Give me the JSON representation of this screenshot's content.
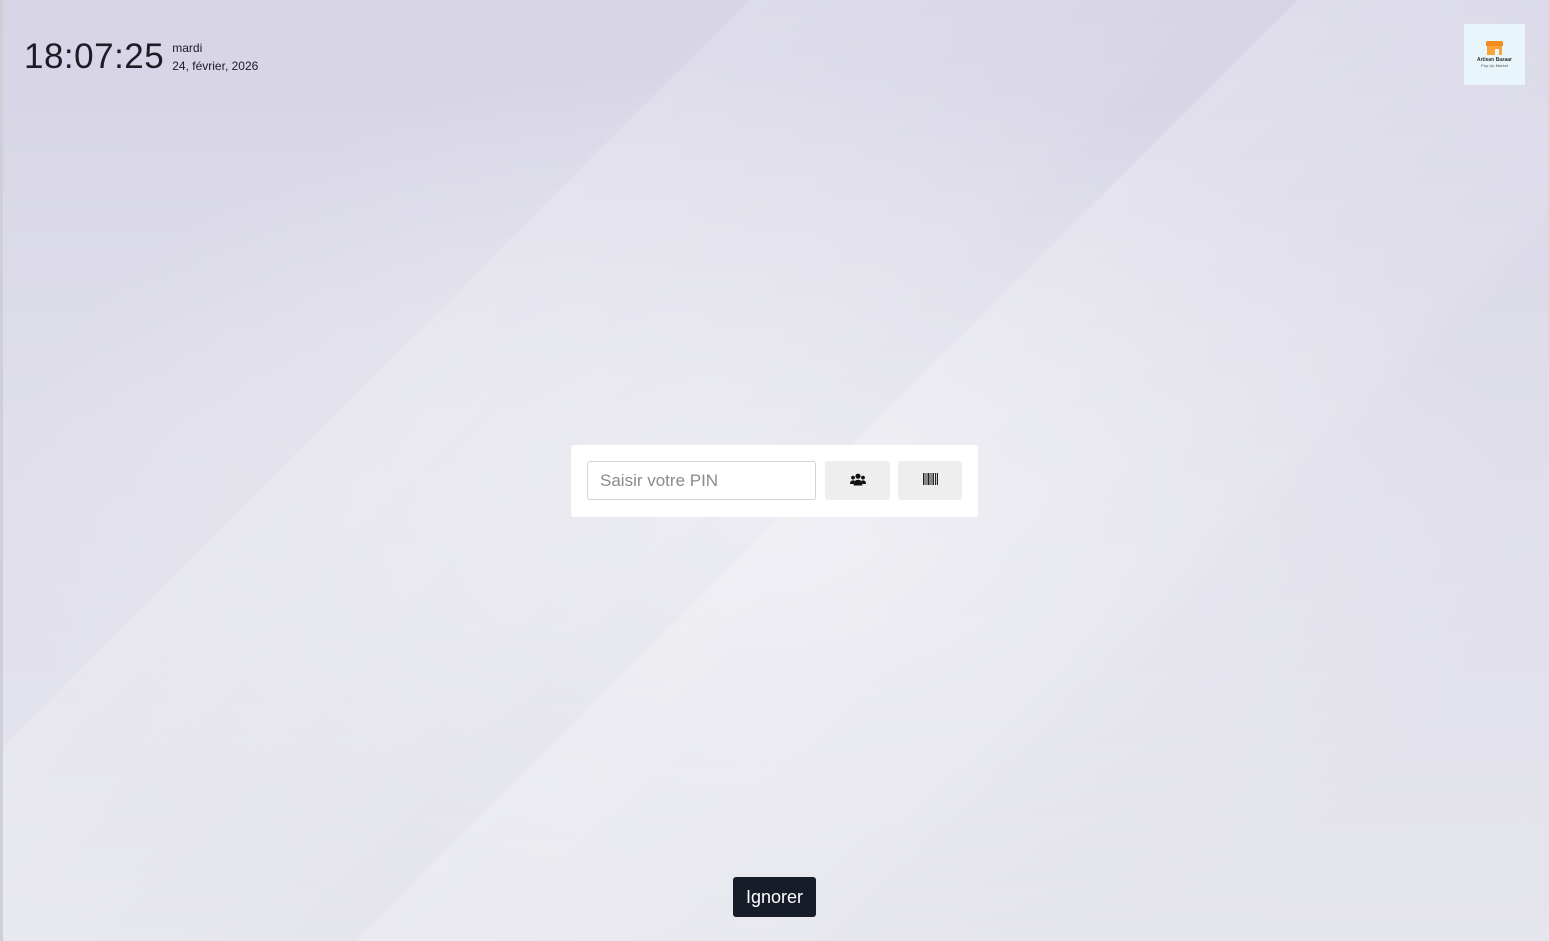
{
  "header": {
    "time": "18:07:25",
    "weekday": "mardi",
    "date": "24, février, 2026"
  },
  "logo": {
    "name": "Artisan Bazaar",
    "tagline": "Pop-Up Market",
    "icon": "storefront-icon"
  },
  "login": {
    "pin_placeholder": "Saisir votre PIN",
    "pin_value": "",
    "users_button_icon": "users-icon",
    "barcode_button_icon": "barcode-icon"
  },
  "footer": {
    "ignore_label": "Ignorer"
  },
  "colors": {
    "button_dark": "#171c29",
    "logo_accent": "#f28a1e",
    "logo_background": "#e8f5fb"
  }
}
